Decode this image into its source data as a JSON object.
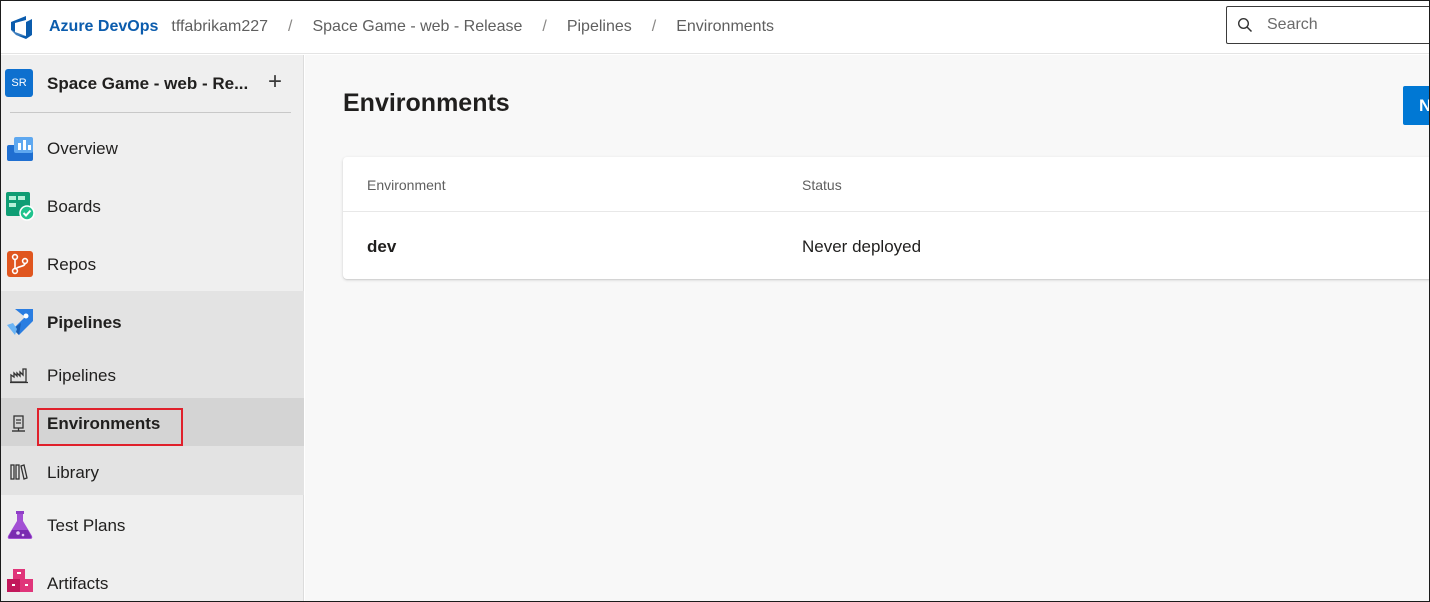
{
  "app": {
    "brand_name": "Azure DevOps"
  },
  "breadcrumb": {
    "items": [
      {
        "label": "tffabrikam227"
      },
      {
        "label": "Space Game - web - Release"
      },
      {
        "label": "Pipelines"
      },
      {
        "label": "Environments"
      }
    ],
    "separator": "/"
  },
  "search": {
    "placeholder": "Search"
  },
  "sidebar": {
    "project": {
      "avatar_initials": "SR",
      "name": "Space Game - web - Re...",
      "add_label": "+"
    },
    "items": [
      {
        "label": "Overview",
        "icon": "overview-icon"
      },
      {
        "label": "Boards",
        "icon": "boards-icon"
      },
      {
        "label": "Repos",
        "icon": "repos-icon"
      },
      {
        "label": "Pipelines",
        "icon": "pipelines-icon"
      },
      {
        "label": "Pipelines",
        "icon": "pipelines-sub-icon"
      },
      {
        "label": "Environments",
        "icon": "environments-icon",
        "selected": true
      },
      {
        "label": "Library",
        "icon": "library-icon"
      },
      {
        "label": "Test Plans",
        "icon": "test-plans-icon"
      },
      {
        "label": "Artifacts",
        "icon": "artifacts-icon"
      }
    ]
  },
  "main": {
    "title": "Environments",
    "new_button_label": "N",
    "table": {
      "columns": [
        "Environment",
        "Status"
      ],
      "rows": [
        {
          "name": "dev",
          "status": "Never deployed"
        }
      ]
    }
  },
  "colors": {
    "accent": "#0078d4",
    "brand_text": "#0b5cad",
    "highlight_box": "#e0202b"
  }
}
